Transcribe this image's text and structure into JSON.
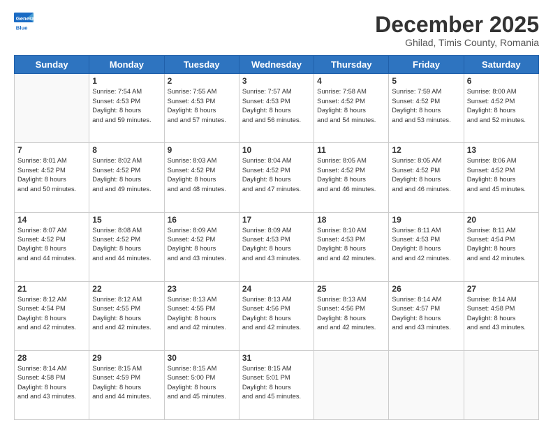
{
  "header": {
    "logo_general": "General",
    "logo_blue": "Blue",
    "month_title": "December 2025",
    "location": "Ghilad, Timis County, Romania"
  },
  "weekdays": [
    "Sunday",
    "Monday",
    "Tuesday",
    "Wednesday",
    "Thursday",
    "Friday",
    "Saturday"
  ],
  "weeks": [
    [
      {
        "day": "",
        "sunrise": "",
        "sunset": "",
        "daylight": ""
      },
      {
        "day": "1",
        "sunrise": "Sunrise: 7:54 AM",
        "sunset": "Sunset: 4:53 PM",
        "daylight": "Daylight: 8 hours and 59 minutes."
      },
      {
        "day": "2",
        "sunrise": "Sunrise: 7:55 AM",
        "sunset": "Sunset: 4:53 PM",
        "daylight": "Daylight: 8 hours and 57 minutes."
      },
      {
        "day": "3",
        "sunrise": "Sunrise: 7:57 AM",
        "sunset": "Sunset: 4:53 PM",
        "daylight": "Daylight: 8 hours and 56 minutes."
      },
      {
        "day": "4",
        "sunrise": "Sunrise: 7:58 AM",
        "sunset": "Sunset: 4:52 PM",
        "daylight": "Daylight: 8 hours and 54 minutes."
      },
      {
        "day": "5",
        "sunrise": "Sunrise: 7:59 AM",
        "sunset": "Sunset: 4:52 PM",
        "daylight": "Daylight: 8 hours and 53 minutes."
      },
      {
        "day": "6",
        "sunrise": "Sunrise: 8:00 AM",
        "sunset": "Sunset: 4:52 PM",
        "daylight": "Daylight: 8 hours and 52 minutes."
      }
    ],
    [
      {
        "day": "7",
        "sunrise": "Sunrise: 8:01 AM",
        "sunset": "Sunset: 4:52 PM",
        "daylight": "Daylight: 8 hours and 50 minutes."
      },
      {
        "day": "8",
        "sunrise": "Sunrise: 8:02 AM",
        "sunset": "Sunset: 4:52 PM",
        "daylight": "Daylight: 8 hours and 49 minutes."
      },
      {
        "day": "9",
        "sunrise": "Sunrise: 8:03 AM",
        "sunset": "Sunset: 4:52 PM",
        "daylight": "Daylight: 8 hours and 48 minutes."
      },
      {
        "day": "10",
        "sunrise": "Sunrise: 8:04 AM",
        "sunset": "Sunset: 4:52 PM",
        "daylight": "Daylight: 8 hours and 47 minutes."
      },
      {
        "day": "11",
        "sunrise": "Sunrise: 8:05 AM",
        "sunset": "Sunset: 4:52 PM",
        "daylight": "Daylight: 8 hours and 46 minutes."
      },
      {
        "day": "12",
        "sunrise": "Sunrise: 8:05 AM",
        "sunset": "Sunset: 4:52 PM",
        "daylight": "Daylight: 8 hours and 46 minutes."
      },
      {
        "day": "13",
        "sunrise": "Sunrise: 8:06 AM",
        "sunset": "Sunset: 4:52 PM",
        "daylight": "Daylight: 8 hours and 45 minutes."
      }
    ],
    [
      {
        "day": "14",
        "sunrise": "Sunrise: 8:07 AM",
        "sunset": "Sunset: 4:52 PM",
        "daylight": "Daylight: 8 hours and 44 minutes."
      },
      {
        "day": "15",
        "sunrise": "Sunrise: 8:08 AM",
        "sunset": "Sunset: 4:52 PM",
        "daylight": "Daylight: 8 hours and 44 minutes."
      },
      {
        "day": "16",
        "sunrise": "Sunrise: 8:09 AM",
        "sunset": "Sunset: 4:52 PM",
        "daylight": "Daylight: 8 hours and 43 minutes."
      },
      {
        "day": "17",
        "sunrise": "Sunrise: 8:09 AM",
        "sunset": "Sunset: 4:53 PM",
        "daylight": "Daylight: 8 hours and 43 minutes."
      },
      {
        "day": "18",
        "sunrise": "Sunrise: 8:10 AM",
        "sunset": "Sunset: 4:53 PM",
        "daylight": "Daylight: 8 hours and 42 minutes."
      },
      {
        "day": "19",
        "sunrise": "Sunrise: 8:11 AM",
        "sunset": "Sunset: 4:53 PM",
        "daylight": "Daylight: 8 hours and 42 minutes."
      },
      {
        "day": "20",
        "sunrise": "Sunrise: 8:11 AM",
        "sunset": "Sunset: 4:54 PM",
        "daylight": "Daylight: 8 hours and 42 minutes."
      }
    ],
    [
      {
        "day": "21",
        "sunrise": "Sunrise: 8:12 AM",
        "sunset": "Sunset: 4:54 PM",
        "daylight": "Daylight: 8 hours and 42 minutes."
      },
      {
        "day": "22",
        "sunrise": "Sunrise: 8:12 AM",
        "sunset": "Sunset: 4:55 PM",
        "daylight": "Daylight: 8 hours and 42 minutes."
      },
      {
        "day": "23",
        "sunrise": "Sunrise: 8:13 AM",
        "sunset": "Sunset: 4:55 PM",
        "daylight": "Daylight: 8 hours and 42 minutes."
      },
      {
        "day": "24",
        "sunrise": "Sunrise: 8:13 AM",
        "sunset": "Sunset: 4:56 PM",
        "daylight": "Daylight: 8 hours and 42 minutes."
      },
      {
        "day": "25",
        "sunrise": "Sunrise: 8:13 AM",
        "sunset": "Sunset: 4:56 PM",
        "daylight": "Daylight: 8 hours and 42 minutes."
      },
      {
        "day": "26",
        "sunrise": "Sunrise: 8:14 AM",
        "sunset": "Sunset: 4:57 PM",
        "daylight": "Daylight: 8 hours and 43 minutes."
      },
      {
        "day": "27",
        "sunrise": "Sunrise: 8:14 AM",
        "sunset": "Sunset: 4:58 PM",
        "daylight": "Daylight: 8 hours and 43 minutes."
      }
    ],
    [
      {
        "day": "28",
        "sunrise": "Sunrise: 8:14 AM",
        "sunset": "Sunset: 4:58 PM",
        "daylight": "Daylight: 8 hours and 43 minutes."
      },
      {
        "day": "29",
        "sunrise": "Sunrise: 8:15 AM",
        "sunset": "Sunset: 4:59 PM",
        "daylight": "Daylight: 8 hours and 44 minutes."
      },
      {
        "day": "30",
        "sunrise": "Sunrise: 8:15 AM",
        "sunset": "Sunset: 5:00 PM",
        "daylight": "Daylight: 8 hours and 45 minutes."
      },
      {
        "day": "31",
        "sunrise": "Sunrise: 8:15 AM",
        "sunset": "Sunset: 5:01 PM",
        "daylight": "Daylight: 8 hours and 45 minutes."
      },
      {
        "day": "",
        "sunrise": "",
        "sunset": "",
        "daylight": ""
      },
      {
        "day": "",
        "sunrise": "",
        "sunset": "",
        "daylight": ""
      },
      {
        "day": "",
        "sunrise": "",
        "sunset": "",
        "daylight": ""
      }
    ]
  ]
}
